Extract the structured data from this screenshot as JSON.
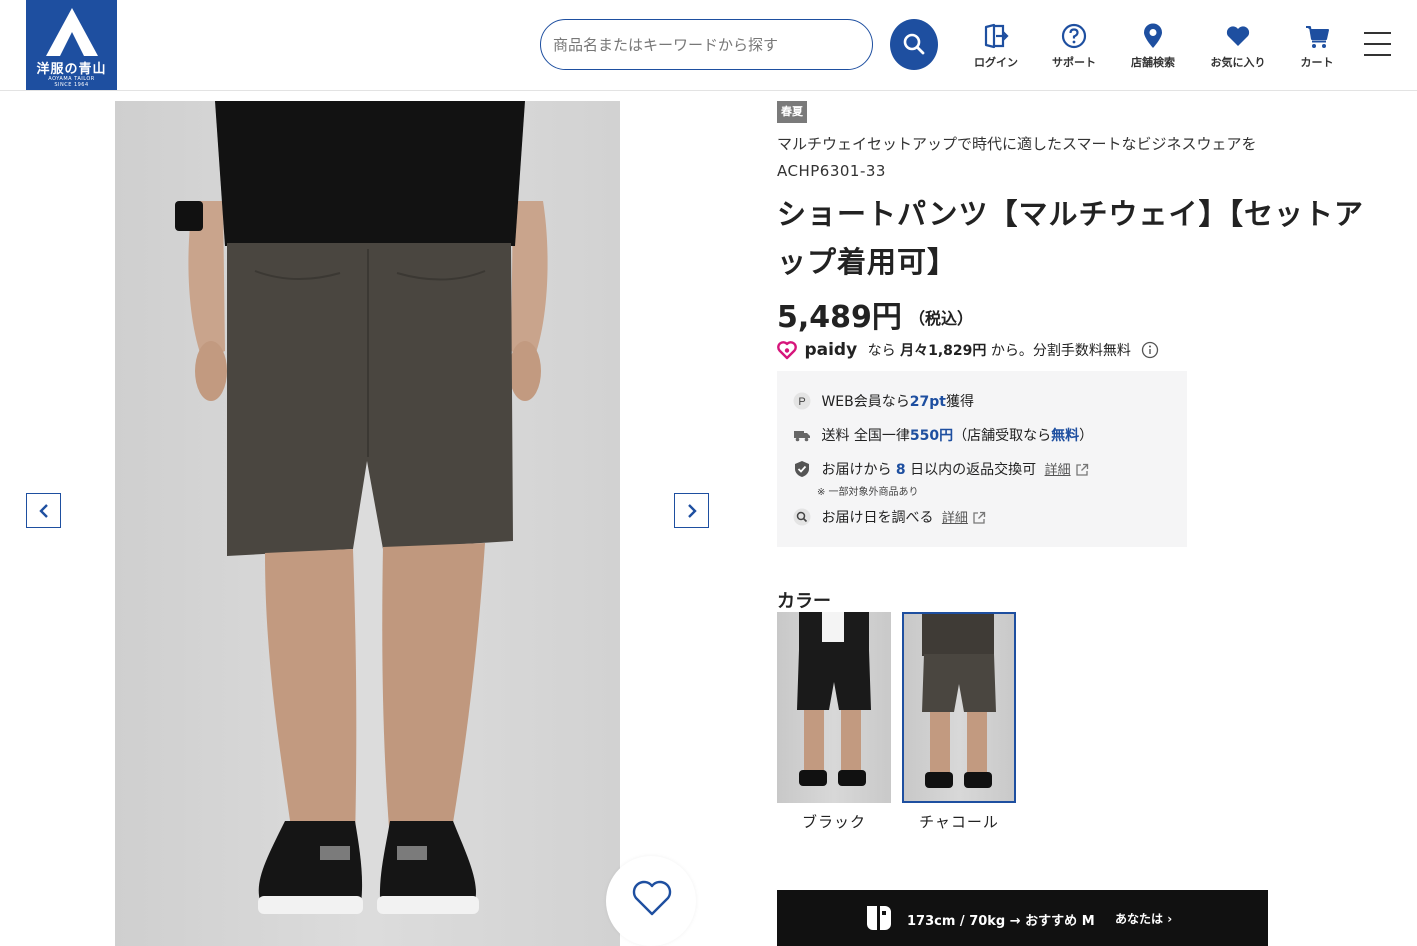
{
  "header": {
    "logo_text_ja": "洋服の青山",
    "logo_text_en_line1": "AOYAMA TAILOR",
    "logo_text_en_line2": "SINCE 1964",
    "search_placeholder": "商品名またはキーワードから探す",
    "nav": [
      {
        "label": "ログイン",
        "icon": "login-icon"
      },
      {
        "label": "サポート",
        "icon": "help-icon"
      },
      {
        "label": "店舗検索",
        "icon": "location-pin-icon"
      },
      {
        "label": "お気に入り",
        "icon": "heart-icon"
      },
      {
        "label": "カート",
        "icon": "cart-icon"
      }
    ]
  },
  "product": {
    "season_tag": "春夏",
    "catch_copy": "マルチウェイセットアップで時代に適したスマートなビジネスウェアを",
    "sku": "ACHP6301-33",
    "title": "ショートパンツ【マルチウェイ】【セットアップ着用可】",
    "price": "5,489円",
    "tax_note": "（税込）",
    "paidy": {
      "brand": "paidy",
      "prefix": "なら",
      "monthly": "月々1,829円",
      "suffix": "から。分割手数料無料"
    },
    "benefits": {
      "points_prefix": "WEB会員なら",
      "points_value": "27pt",
      "points_suffix": "獲得",
      "shipping_prefix": "送料 全国一律",
      "shipping_value": "550円",
      "shipping_mid": "（店舗受取なら",
      "shipping_free": "無料",
      "shipping_suffix": "）",
      "returns_prefix": "お届けから",
      "returns_days": "8",
      "returns_suffix": "日以内の返品交換可",
      "returns_link": "詳細",
      "returns_note": "※ 一部対象外商品あり",
      "delivery_text": "お届け日を調べる",
      "delivery_link": "詳細"
    },
    "color_heading": "カラー",
    "colors": [
      {
        "label": "ブラック",
        "selected": false,
        "swatch": "#1a1a1a"
      },
      {
        "label": "チャコール",
        "selected": true,
        "swatch": "#4a4640"
      }
    ],
    "fit": {
      "text": "173cm / 70kg → おすすめ M",
      "you": "あなたは"
    }
  },
  "colors": {
    "brand": "#1e4fa0",
    "paidy": "#d6157b",
    "pants_charcoal": "#4a4640"
  }
}
